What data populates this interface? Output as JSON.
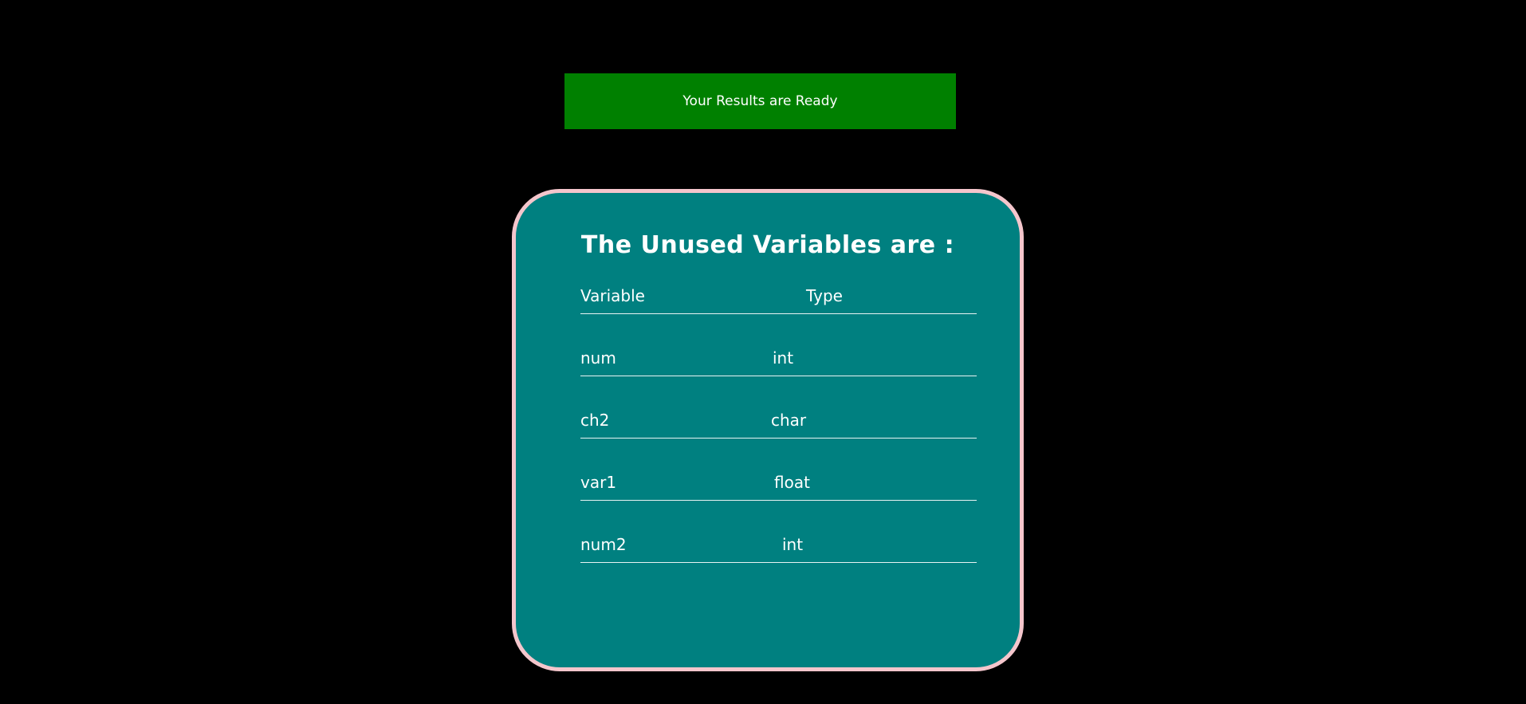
{
  "banner": {
    "text": "Your Results are Ready"
  },
  "card": {
    "title": "The Unused Variables are :",
    "headers": {
      "variable": "Variable",
      "type": "Type"
    },
    "rows": [
      {
        "variable": "num",
        "type": "int"
      },
      {
        "variable": "ch2",
        "type": "char"
      },
      {
        "variable": "var1",
        "type": "float"
      },
      {
        "variable": "num2",
        "type": "int"
      }
    ]
  },
  "colors": {
    "background": "#000000",
    "banner": "#008000",
    "card": "#008080",
    "card_border": "#f4c6cc",
    "text": "#ffffff"
  }
}
